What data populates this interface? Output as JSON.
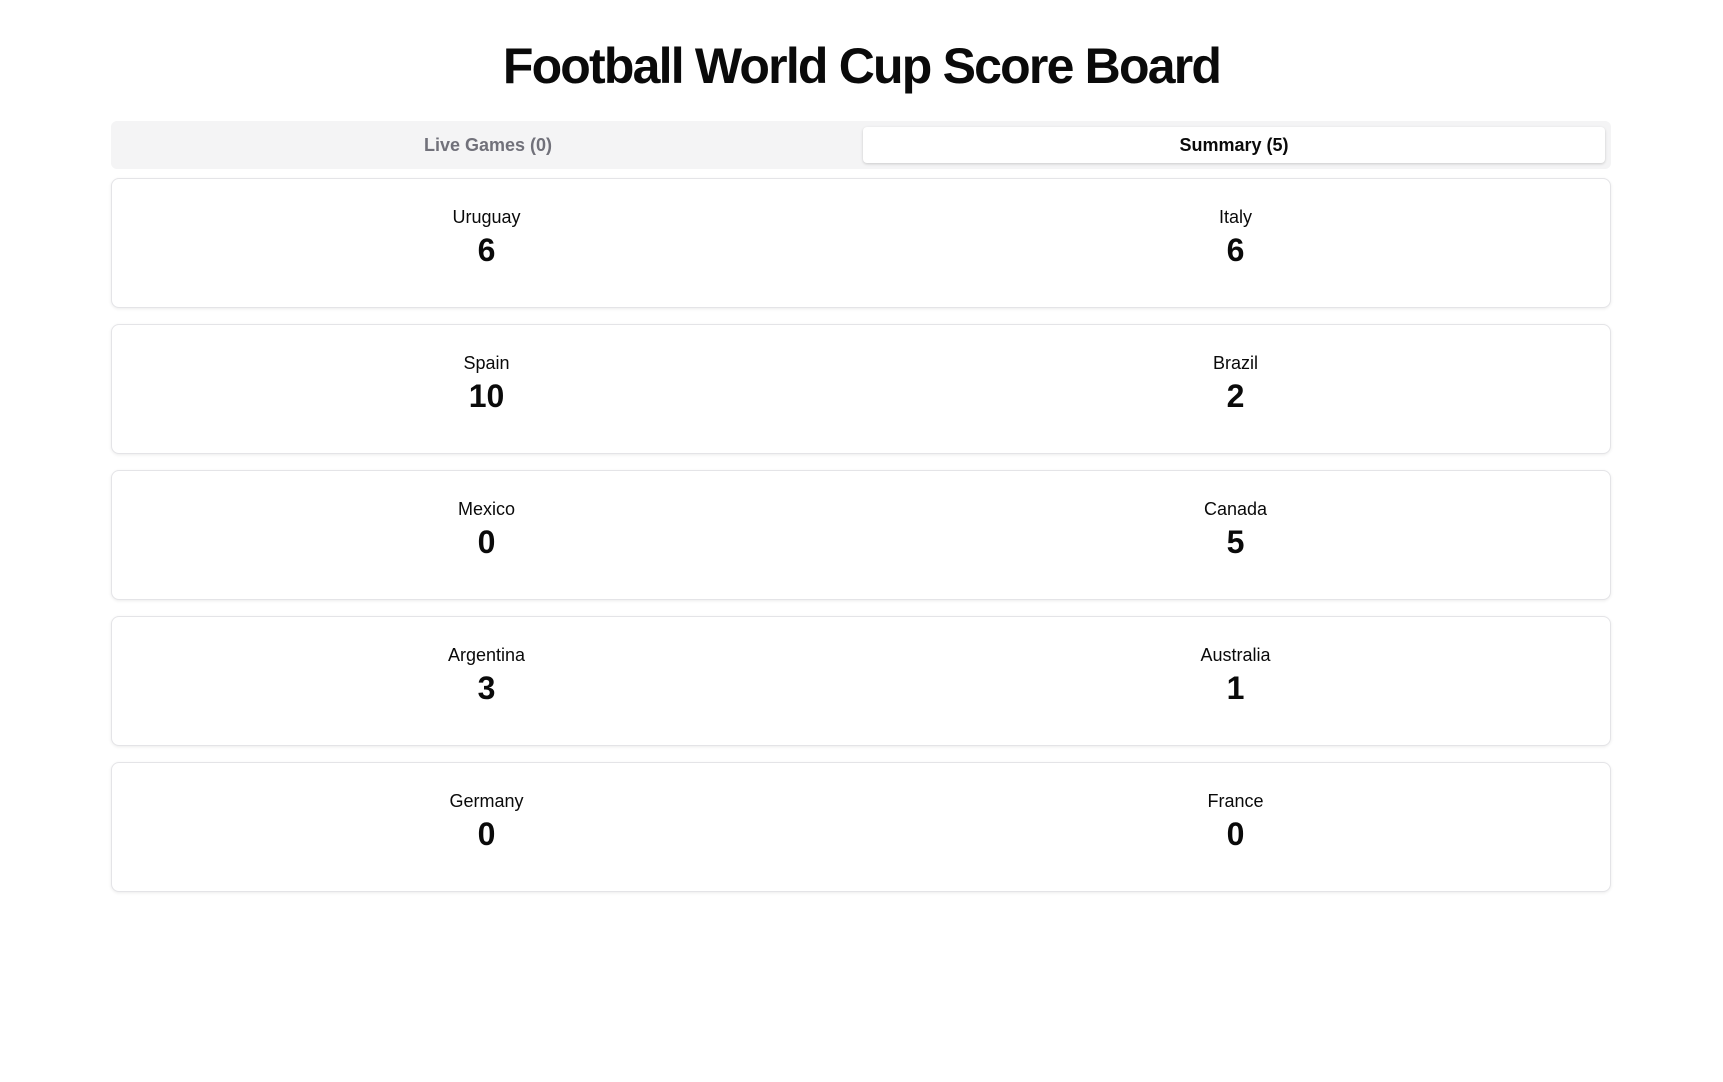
{
  "page": {
    "title": "Football World Cup Score Board"
  },
  "tabs": [
    {
      "label": "Live Games (0)",
      "active": false
    },
    {
      "label": "Summary (5)",
      "active": true
    }
  ],
  "games": [
    {
      "home": {
        "name": "Uruguay",
        "score": "6"
      },
      "away": {
        "name": "Italy",
        "score": "6"
      }
    },
    {
      "home": {
        "name": "Spain",
        "score": "10"
      },
      "away": {
        "name": "Brazil",
        "score": "2"
      }
    },
    {
      "home": {
        "name": "Mexico",
        "score": "0"
      },
      "away": {
        "name": "Canada",
        "score": "5"
      }
    },
    {
      "home": {
        "name": "Argentina",
        "score": "3"
      },
      "away": {
        "name": "Australia",
        "score": "1"
      }
    },
    {
      "home": {
        "name": "Germany",
        "score": "0"
      },
      "away": {
        "name": "France",
        "score": "0"
      }
    }
  ],
  "colors": {
    "text": "#0a0a0a",
    "muted": "#71717a",
    "tab_bg": "#f4f4f5",
    "border": "#e4e4e7"
  }
}
